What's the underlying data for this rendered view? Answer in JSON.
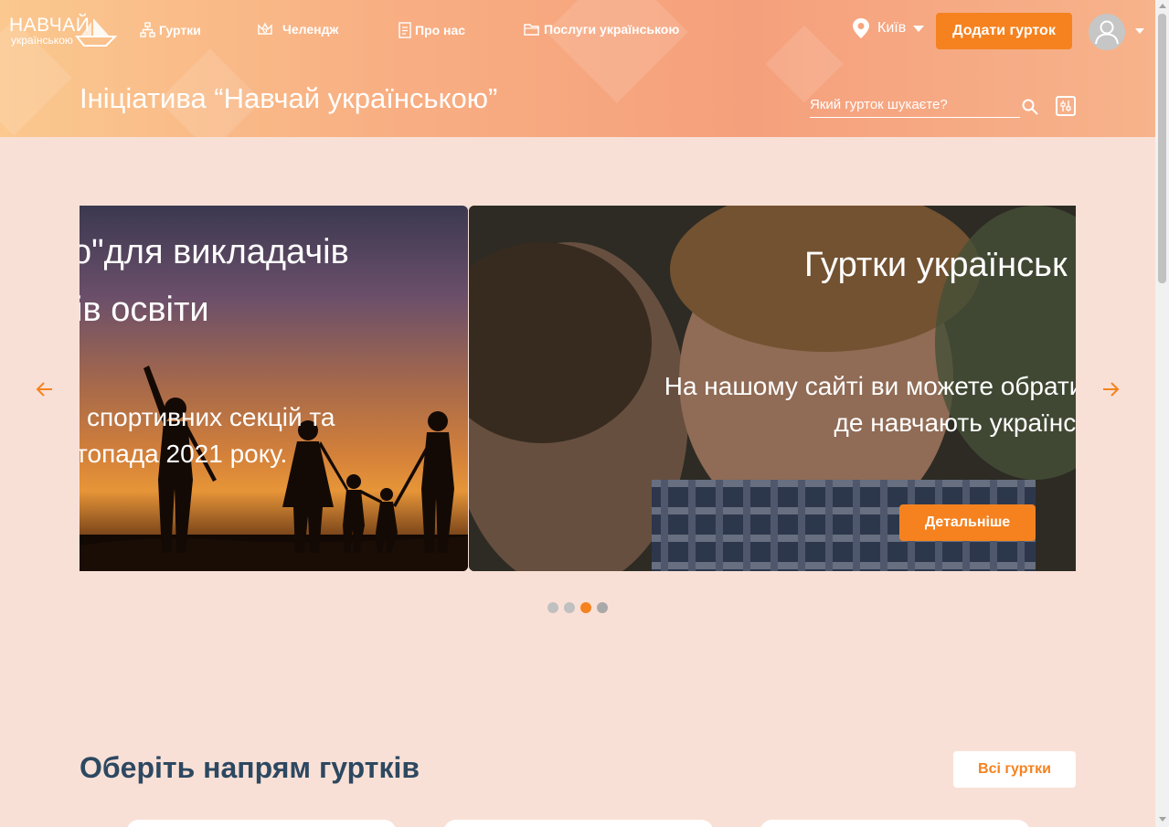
{
  "logo": {
    "line1": "НАВЧАЙ",
    "line2": "українською"
  },
  "nav": {
    "items": [
      {
        "label": "Гуртки",
        "icon": "sitemap-icon"
      },
      {
        "label": "Челендж",
        "icon": "crown-icon"
      },
      {
        "label": "Про нас",
        "icon": "document-icon"
      },
      {
        "label": "Послуги українською",
        "icon": "folder-icon"
      }
    ]
  },
  "city": {
    "label": "Київ",
    "icon": "location-pin-icon"
  },
  "header": {
    "add_button": "Додати гурток",
    "page_title": "Ініціатива “Навчай українською”",
    "search_placeholder": "Який гурток шукаєте?"
  },
  "carousel": {
    "slide1": {
      "title_lines": [
        "о\"для викладачів",
        "ів освіти"
      ],
      "text_lines": [
        "спортивних секцій та",
        "топада 2021 року."
      ]
    },
    "slide2": {
      "title": "Гуртки українськ",
      "text_lines": [
        "На нашому сайті ви можете обрати для",
        "де навчають українською"
      ],
      "button": "Детальніше"
    },
    "dots": 4,
    "active_dot": 3
  },
  "section": {
    "title": "Оберіть напрям гуртків",
    "all_button": "Всі гуртки"
  },
  "colors": {
    "accent": "#f5821f",
    "title": "#2d4861",
    "background": "#f9e0d6"
  }
}
